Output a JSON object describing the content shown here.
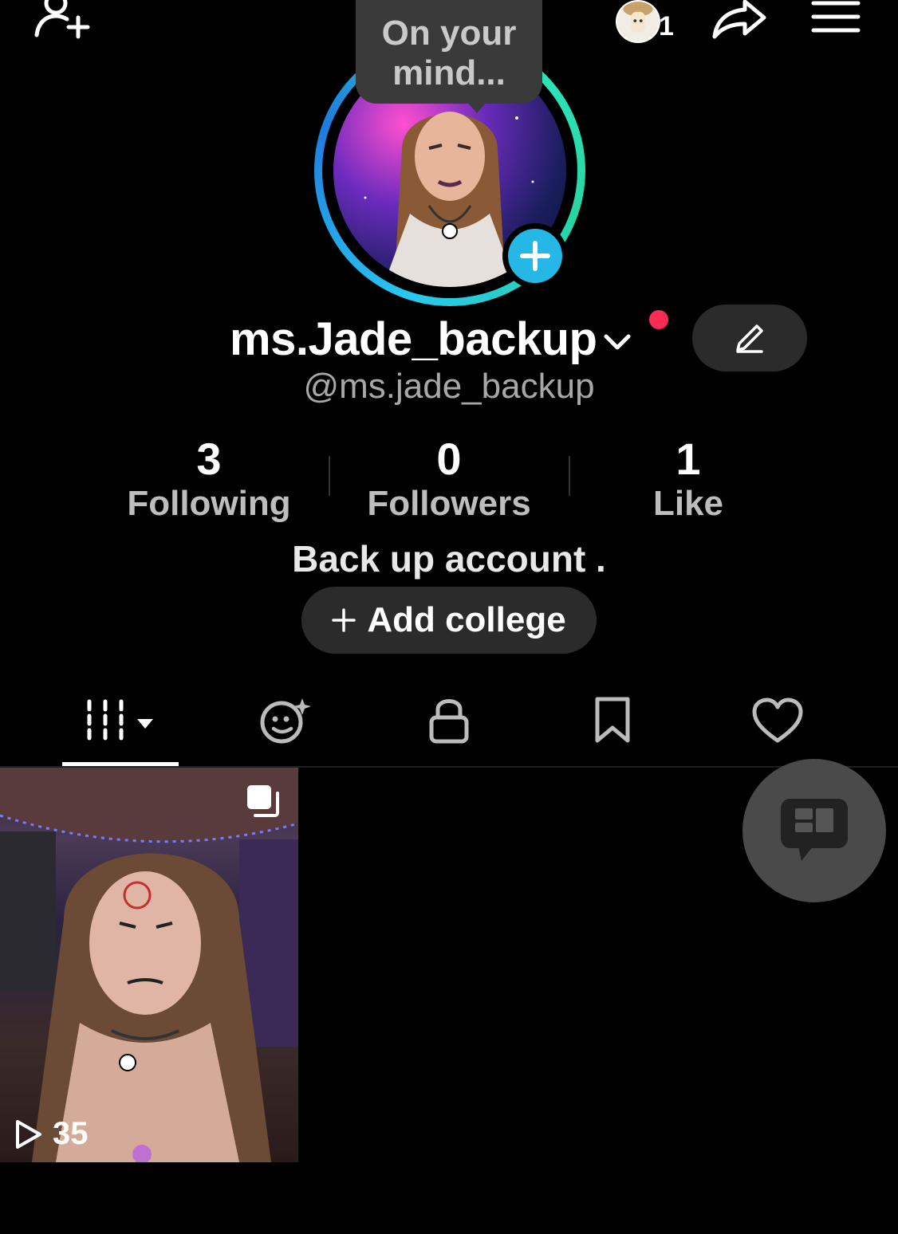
{
  "top_bar": {
    "story_count": "1"
  },
  "profile": {
    "note_bubble_line1": "On your",
    "note_bubble_line2": "mind...",
    "display_name": "ms.Jade_backup",
    "handle": "@ms.jade_backup",
    "bio": "Back up account .",
    "add_college_label": "Add college"
  },
  "stats": [
    {
      "value": "3",
      "label": "Following"
    },
    {
      "value": "0",
      "label": "Followers"
    },
    {
      "value": "1",
      "label": "Like"
    }
  ],
  "tabs": [
    {
      "icon": "videos-grid-icon",
      "active": true
    },
    {
      "icon": "reposts-smile-icon",
      "active": false
    },
    {
      "icon": "lock-icon",
      "active": false
    },
    {
      "icon": "bookmark-icon",
      "active": false
    },
    {
      "icon": "heart-icon",
      "active": false
    }
  ],
  "videos": [
    {
      "views": "35"
    }
  ],
  "colors": {
    "accent_blue": "#25b7e6",
    "notification_red": "#fe2c55",
    "button_bg": "#2b2b2b"
  }
}
